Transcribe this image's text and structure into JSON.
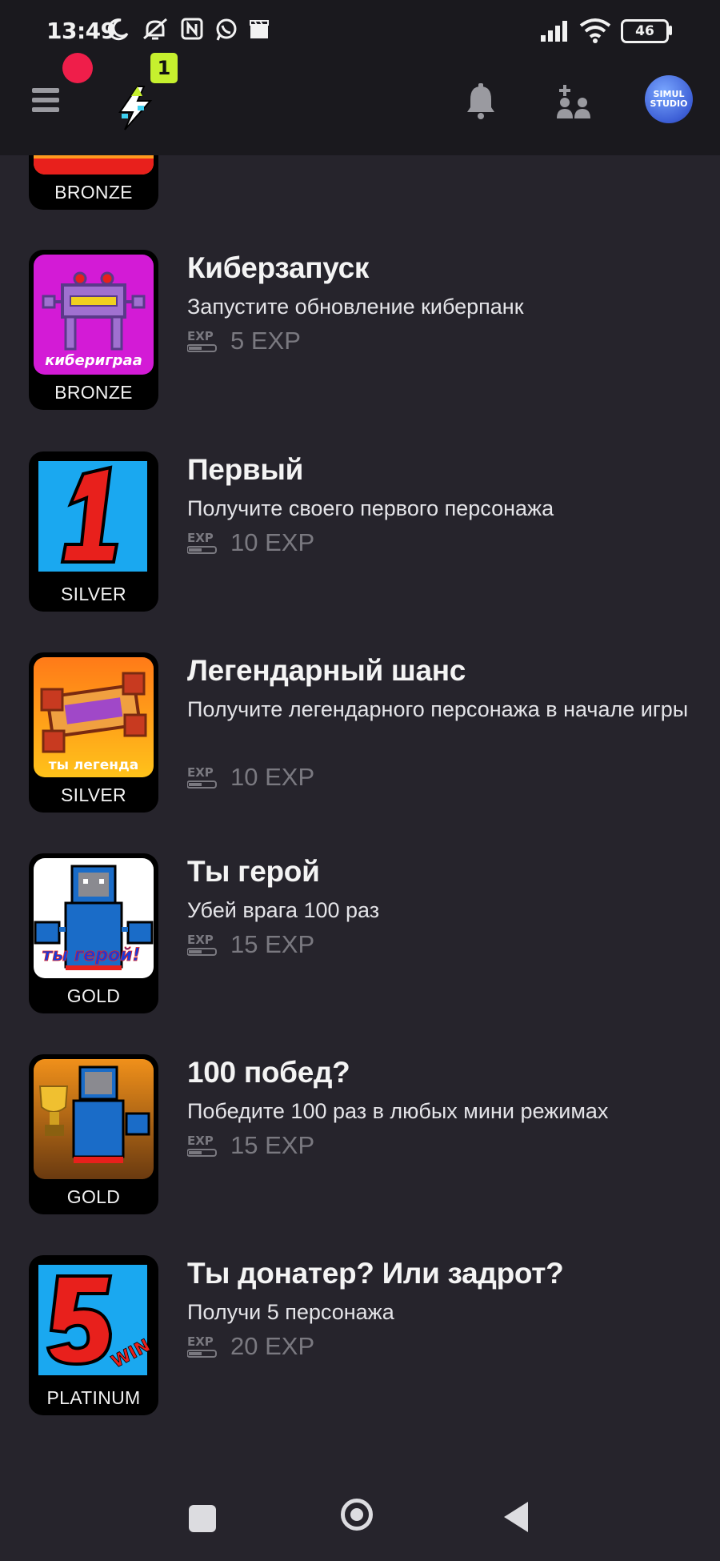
{
  "status_bar": {
    "time": "13:49",
    "battery": "46",
    "icons": [
      "moon-icon",
      "alarm-off-icon",
      "nfc-icon",
      "whatsapp-icon",
      "clapperboard-icon",
      "signal-icon",
      "wifi-icon",
      "battery-icon"
    ]
  },
  "header": {
    "notification_count": "1",
    "avatar_text_1": "SIMUL",
    "avatar_text_2": "STUDIO",
    "icons": [
      "menu-icon",
      "bolt-icon",
      "bell-icon",
      "add-friend-icon"
    ]
  },
  "achievements": [
    {
      "title": "",
      "desc": "",
      "exp": "",
      "tier": "BRONZE",
      "art": "partial-top"
    },
    {
      "title": "Киберзапуск",
      "desc": "Запустите обновление киберпанк",
      "exp": "5 EXP",
      "tier": "BRONZE",
      "art_text": "кибериграа"
    },
    {
      "title": "Первый",
      "desc": "Получите своего первого персонажа",
      "exp": "10 EXP",
      "tier": "SILVER"
    },
    {
      "title": "Легендарный шанс",
      "desc": "Получите легендарного персонажа в начале игры",
      "exp": "10 EXP",
      "tier": "SILVER",
      "art_text": "ты легенда"
    },
    {
      "title": "Ты герой",
      "desc": "Убей врага 100 раз",
      "exp": "15 EXP",
      "tier": "GOLD",
      "art_text": "ты герой!"
    },
    {
      "title": "100 побед?",
      "desc": "Победите 100 раз в любых мини режимах",
      "exp": "15 EXP",
      "tier": "GOLD"
    },
    {
      "title": "Ты донатер? Или задрот?",
      "desc": "Получи 5 персонажа",
      "exp": "20 EXP",
      "tier": "PLATINUM",
      "art_text": "WIN"
    }
  ],
  "navbar": {
    "icons": [
      "recents-icon",
      "home-icon",
      "back-icon"
    ]
  },
  "colors": {
    "background": "#26242c",
    "header": "#1a191e",
    "badge": "#c6f02e",
    "record": "#ef1e4a"
  }
}
